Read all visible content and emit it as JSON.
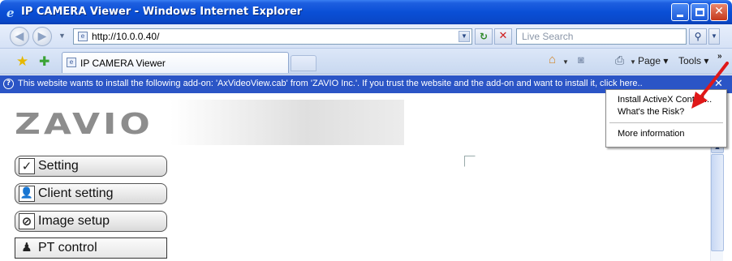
{
  "window": {
    "title": "IP CAMERA Viewer - Windows Internet Explorer",
    "ie_glyph": "e",
    "min_glyph": "_",
    "close_glyph": "✕"
  },
  "address_bar": {
    "url": "http://10.0.0.40/",
    "search_placeholder": "Live Search",
    "back_glyph": "◀",
    "forward_glyph": "▶",
    "refresh_glyph": "↻",
    "stop_glyph": "✕",
    "search_glyph": "⚲"
  },
  "tab": {
    "label": "IP CAMERA Viewer"
  },
  "command_bar": {
    "page_label": "Page ▾",
    "tools_label": "Tools ▾",
    "more_glyph": "»"
  },
  "info_bar": {
    "message": "This website wants to install the following add-on: 'AxVideoView.cab' from 'ZAVIO Inc.'. If you trust the website and the add-on and want to install it, click here...",
    "close_glyph": "✕"
  },
  "context_menu": {
    "items": [
      "Install ActiveX Control...",
      "What's the Risk?",
      "More information"
    ]
  },
  "page": {
    "logo": "ZAVIO",
    "nav": [
      {
        "label": "Setting",
        "icon": "check-icon",
        "glyph": "✓"
      },
      {
        "label": "Client setting",
        "icon": "user-icon",
        "glyph": "👤"
      },
      {
        "label": "Image setup",
        "icon": "image-icon",
        "glyph": "⊘"
      },
      {
        "label": "PT control",
        "icon": "joystick-icon",
        "glyph": "♟"
      }
    ]
  },
  "colors": {
    "titlebar": "#0a4fd6",
    "infobar": "#2b55c6",
    "annotation_arrow": "#e01818"
  }
}
